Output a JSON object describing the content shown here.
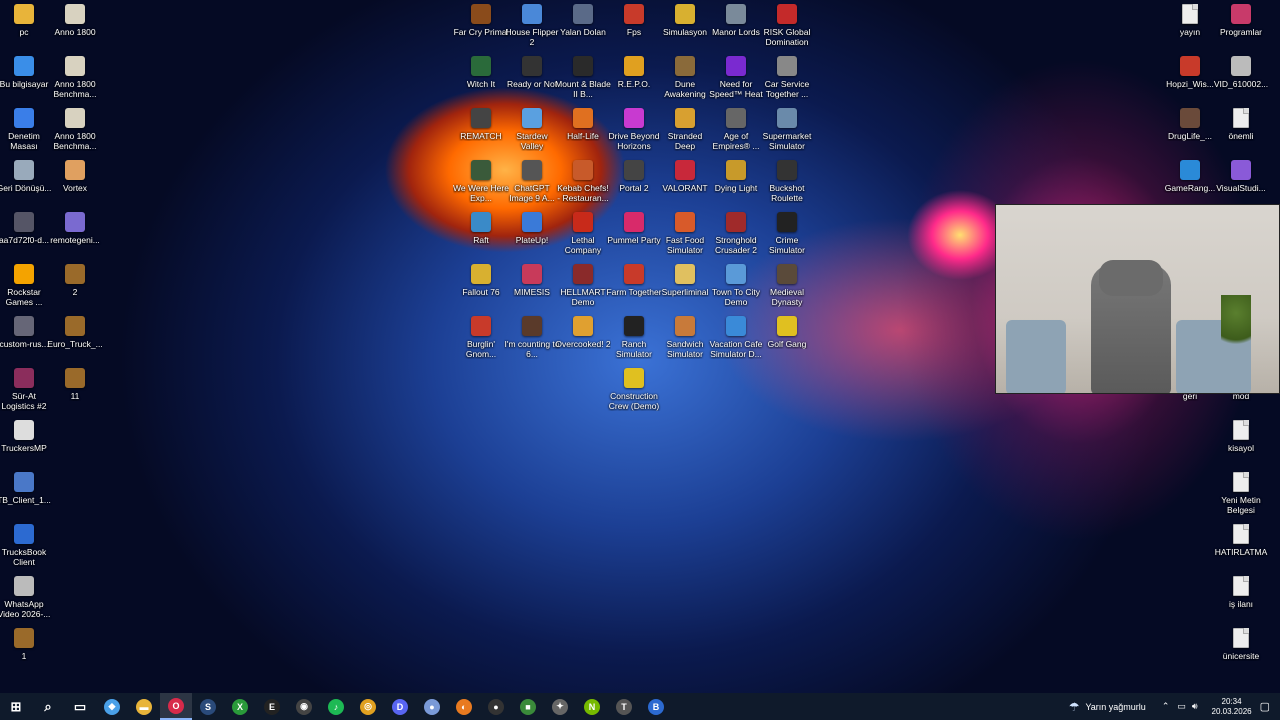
{
  "desktop": {
    "left_col1": [
      {
        "label": "pc",
        "icon": "folder-icon",
        "color": "#e8b43a"
      },
      {
        "label": "Bu bilgisayar",
        "icon": "computer-icon",
        "color": "#3a8ee8"
      },
      {
        "label": "Denetim Masası",
        "icon": "control-panel-icon",
        "color": "#3a7ee8"
      },
      {
        "label": "Geri Dönüşü...",
        "icon": "recycle-bin-icon",
        "color": "#9ab"
      },
      {
        "label": "aa7d72f0-d...",
        "icon": "image-icon",
        "color": "#556"
      },
      {
        "label": "Rockstar Games ...",
        "icon": "rockstar-icon",
        "color": "#f4a300"
      },
      {
        "label": "custom-rus...",
        "icon": "image-icon",
        "color": "#667"
      },
      {
        "label": "Sür-At Logistics #2",
        "icon": "winrar-icon",
        "color": "#8b2d5c"
      },
      {
        "label": "TruckersMP",
        "icon": "truck-icon",
        "color": "#ddd"
      },
      {
        "label": "TB_Client_1...",
        "icon": "file-icon",
        "color": "#4a78c8"
      },
      {
        "label": "TrucksBook Client",
        "icon": "trucksbook-icon",
        "color": "#2c6ad1"
      },
      {
        "label": "WhatsApp Video 2026-...",
        "icon": "video-icon",
        "color": "#bbb"
      },
      {
        "label": "1",
        "icon": "archive-icon",
        "color": "#9a6a2a"
      }
    ],
    "left_col2": [
      {
        "label": "Anno 1800",
        "icon": "anno-icon",
        "color": "#d8d2c0"
      },
      {
        "label": "Anno 1800 Benchma...",
        "icon": "anno-icon",
        "color": "#d8d2c0"
      },
      {
        "label": "Anno 1800 Benchma...",
        "icon": "anno-icon",
        "color": "#d8d2c0"
      },
      {
        "label": "Vortex",
        "icon": "vortex-icon",
        "color": "#e0a060"
      },
      {
        "label": "remotegeni...",
        "icon": "remote-icon",
        "color": "#7a6ad0"
      },
      {
        "label": "2",
        "icon": "archive-icon",
        "color": "#9a6a2a"
      },
      {
        "label": "Euro_Truck_...",
        "icon": "archive-icon",
        "color": "#9a6a2a"
      },
      {
        "label": "11",
        "icon": "archive-icon",
        "color": "#9a6a2a"
      }
    ],
    "grid": [
      [
        {
          "label": "Far Cry Primal",
          "icon": "game-icon",
          "color": "#8a4b1b"
        },
        {
          "label": "House Flipper 2",
          "icon": "game-icon",
          "color": "#4a88d8"
        },
        {
          "label": "Yalan Dolan",
          "icon": "game-icon",
          "color": "#5a6a88"
        },
        {
          "label": "Fps",
          "icon": "game-icon",
          "color": "#c83a2a"
        },
        {
          "label": "Simulasyon",
          "icon": "folder-icon",
          "color": "#d8b030"
        },
        {
          "label": "Manor Lords",
          "icon": "game-icon",
          "color": "#7a8a9a"
        },
        {
          "label": "RISK Global Domination",
          "icon": "game-icon",
          "color": "#c42a2a"
        }
      ],
      [
        {
          "label": "Witch It",
          "icon": "game-icon",
          "color": "#2a6a3a"
        },
        {
          "label": "Ready or Not",
          "icon": "game-icon",
          "color": "#333"
        },
        {
          "label": "Mount & Blade II B...",
          "icon": "game-icon",
          "color": "#2a2a2a"
        },
        {
          "label": "R.E.P.O.",
          "icon": "game-icon",
          "color": "#e0a020"
        },
        {
          "label": "Dune Awakening",
          "icon": "game-icon",
          "color": "#8a6a3a"
        },
        {
          "label": "Need for Speed™ Heat",
          "icon": "game-icon",
          "color": "#7a2ad0"
        },
        {
          "label": "Car Service Together ...",
          "icon": "game-icon",
          "color": "#888"
        }
      ],
      [
        {
          "label": "REMATCH",
          "icon": "game-icon",
          "color": "#444"
        },
        {
          "label": "Stardew Valley",
          "icon": "game-icon",
          "color": "#5aa0e0"
        },
        {
          "label": "Half-Life",
          "icon": "game-icon",
          "color": "#e07020"
        },
        {
          "label": "Drive Beyond Horizons",
          "icon": "game-icon",
          "color": "#c83ad0"
        },
        {
          "label": "Stranded Deep",
          "icon": "game-icon",
          "color": "#d8a030"
        },
        {
          "label": "Age of Empires® ...",
          "icon": "game-icon",
          "color": "#666"
        },
        {
          "label": "Supermarket Simulator",
          "icon": "game-icon",
          "color": "#6a8aaa"
        }
      ],
      [
        {
          "label": "We Were Here Exp...",
          "icon": "game-icon",
          "color": "#3a5a3a"
        },
        {
          "label": "ChatGPT Image 9 A...",
          "icon": "image-icon",
          "color": "#555"
        },
        {
          "label": "Kebab Chefs! - Restauran...",
          "icon": "game-icon",
          "color": "#c85a2a"
        },
        {
          "label": "Portal 2",
          "icon": "game-icon",
          "color": "#444"
        },
        {
          "label": "VALORANT",
          "icon": "game-icon",
          "color": "#c8283a"
        },
        {
          "label": "Dying Light",
          "icon": "game-icon",
          "color": "#c89a2a"
        },
        {
          "label": "Buckshot Roulette",
          "icon": "game-icon",
          "color": "#333"
        }
      ],
      [
        {
          "label": "Raft",
          "icon": "game-icon",
          "color": "#3a8ac8"
        },
        {
          "label": "PlateUp!",
          "icon": "game-icon",
          "color": "#3a7ad8"
        },
        {
          "label": "Lethal Company",
          "icon": "game-icon",
          "color": "#c82a1a"
        },
        {
          "label": "Pummel Party",
          "icon": "game-icon",
          "color": "#d82a6a"
        },
        {
          "label": "Fast Food Simulator",
          "icon": "game-icon",
          "color": "#d85a2a"
        },
        {
          "label": "Stronghold Crusader 2",
          "icon": "game-icon",
          "color": "#a02a2a"
        },
        {
          "label": "Crime Simulator",
          "icon": "game-icon",
          "color": "#222"
        }
      ],
      [
        {
          "label": "Fallout 76",
          "icon": "game-icon",
          "color": "#d8b030"
        },
        {
          "label": "MIMESIS",
          "icon": "game-icon",
          "color": "#c83a5a"
        },
        {
          "label": "HELLMART Demo",
          "icon": "game-icon",
          "color": "#8a2a2a"
        },
        {
          "label": "Farm Together",
          "icon": "game-icon",
          "color": "#c83a2a"
        },
        {
          "label": "Superliminal",
          "icon": "game-icon",
          "color": "#e0c060"
        },
        {
          "label": "Town To City Demo",
          "icon": "game-icon",
          "color": "#5a9ad8"
        },
        {
          "label": "Medieval Dynasty",
          "icon": "game-icon",
          "color": "#5a4a3a"
        }
      ],
      [
        {
          "label": "Burglin' Gnom...",
          "icon": "game-icon",
          "color": "#c83a2a"
        },
        {
          "label": "I'm counting to 6...",
          "icon": "game-icon",
          "color": "#5a3a2a"
        },
        {
          "label": "Overcooked! 2",
          "icon": "game-icon",
          "color": "#e0a030"
        },
        {
          "label": "Ranch Simulator",
          "icon": "game-icon",
          "color": "#222"
        },
        {
          "label": "Sandwich Simulator",
          "icon": "game-icon",
          "color": "#c87a3a"
        },
        {
          "label": "Vacation Cafe Simulator D...",
          "icon": "game-icon",
          "color": "#3a8ad8"
        },
        {
          "label": "Golf Gang",
          "icon": "game-icon",
          "color": "#e0c020"
        }
      ],
      [
        null,
        null,
        null,
        {
          "label": "Construction Crew (Demo)",
          "icon": "game-icon",
          "color": "#e0c020"
        }
      ]
    ],
    "right_col1": [
      {
        "label": "yayın",
        "icon": "document-icon",
        "color": "#eee",
        "row": 0
      },
      {
        "label": "Hopzi_Wis...",
        "icon": "image-icon",
        "color": "#c83a2a",
        "row": 1
      },
      {
        "label": "DrugLife_...",
        "icon": "image-icon",
        "color": "#6a4a3a",
        "row": 2
      },
      {
        "label": "GameRang...",
        "icon": "gameranger-icon",
        "color": "#2a8ad8",
        "row": 3
      },
      {
        "label": "geri",
        "icon": "document-icon",
        "color": "#eee",
        "row": 7
      }
    ],
    "right_col2": [
      {
        "label": "Programlar",
        "icon": "folder-icon",
        "color": "#c83a6a",
        "row": 0
      },
      {
        "label": "VID_610002...",
        "icon": "video-icon",
        "color": "#bbb",
        "row": 1
      },
      {
        "label": "önemli",
        "icon": "document-icon",
        "color": "#eee",
        "row": 2
      },
      {
        "label": "VisualStudi...",
        "icon": "visualstudio-icon",
        "color": "#8a5ad8",
        "row": 3
      },
      {
        "label": "mod",
        "icon": "document-icon",
        "color": "#eee",
        "row": 7
      },
      {
        "label": "kisayol",
        "icon": "document-icon",
        "color": "#eee",
        "row": 8
      },
      {
        "label": "Yeni Metin Belgesi",
        "icon": "document-icon",
        "color": "#eee",
        "row": 9
      },
      {
        "label": "HATIRLATMA",
        "icon": "document-icon",
        "color": "#eee",
        "row": 10
      },
      {
        "label": "iş ilanı",
        "icon": "document-icon",
        "color": "#eee",
        "row": 11
      },
      {
        "label": "ünicersite",
        "icon": "document-icon",
        "color": "#eee",
        "row": 12
      }
    ]
  },
  "taskbar": {
    "apps": [
      {
        "name": "start-button",
        "glyph": "⊞",
        "color": "#ffffff"
      },
      {
        "name": "search-icon",
        "glyph": "⌕",
        "color": "#ffffff"
      },
      {
        "name": "task-view-icon",
        "glyph": "▭",
        "color": "#ffffff"
      },
      {
        "name": "copilot-icon",
        "glyph": "◆",
        "color": "#4aa0e8"
      },
      {
        "name": "file-explorer-icon",
        "glyph": "▬",
        "color": "#e8b43a"
      },
      {
        "name": "opera-gx-icon",
        "glyph": "O",
        "color": "#d82a4a"
      },
      {
        "name": "steam-icon",
        "glyph": "S",
        "color": "#2a4a7a"
      },
      {
        "name": "xbox-icon",
        "glyph": "X",
        "color": "#2a9a3a"
      },
      {
        "name": "epic-games-icon",
        "glyph": "E",
        "color": "#222222"
      },
      {
        "name": "obs-icon",
        "glyph": "◉",
        "color": "#444444"
      },
      {
        "name": "spotify-icon",
        "glyph": "♪",
        "color": "#1db954"
      },
      {
        "name": "chrome-icon",
        "glyph": "◎",
        "color": "#e0a020"
      },
      {
        "name": "discord-icon",
        "glyph": "D",
        "color": "#5865f2"
      },
      {
        "name": "app-icon",
        "glyph": "●",
        "color": "#7a9ad8"
      },
      {
        "name": "blender-icon",
        "glyph": "◐",
        "color": "#e87a20"
      },
      {
        "name": "obs-studio-icon",
        "glyph": "●",
        "color": "#333333"
      },
      {
        "name": "minecraft-icon",
        "glyph": "■",
        "color": "#3a8a3a"
      },
      {
        "name": "inkscape-icon",
        "glyph": "✦",
        "color": "#666666"
      },
      {
        "name": "nvidia-icon",
        "glyph": "N",
        "color": "#76b900"
      },
      {
        "name": "truckersmp-icon",
        "glyph": "T",
        "color": "#555555"
      },
      {
        "name": "trucksbook-icon",
        "glyph": "B",
        "color": "#2c6ad1"
      }
    ],
    "weather_text": "Yarın yağmurlu",
    "time": "20:34",
    "date": "20.03.2026"
  }
}
